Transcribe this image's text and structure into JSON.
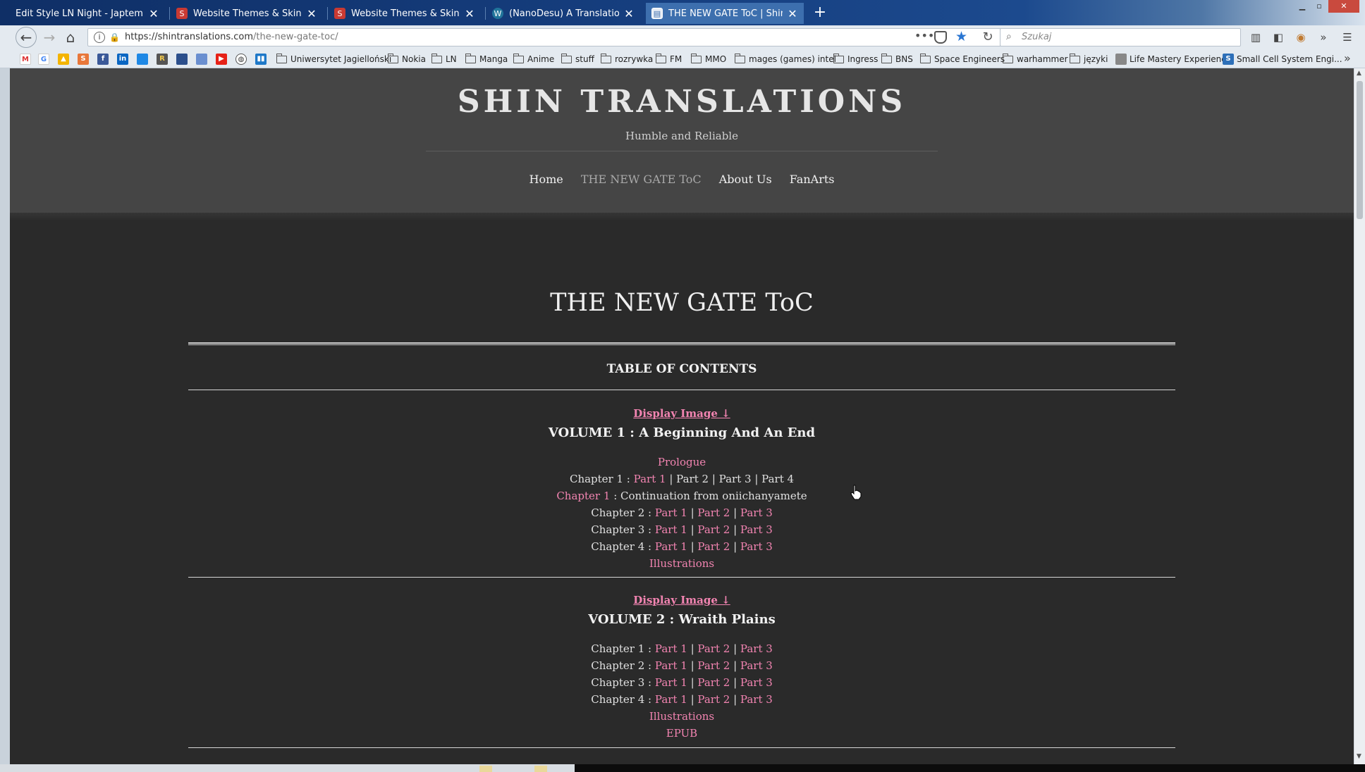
{
  "browser": {
    "tabs": [
      {
        "title": "Edit Style LN Night - Japtem",
        "favicon": "none"
      },
      {
        "title": "Website Themes & Skins by St",
        "favicon": "stylish-icon"
      },
      {
        "title": "Website Themes & Skins by St",
        "favicon": "stylish-icon"
      },
      {
        "title": "(NanoDesu) A Translation of th",
        "favicon": "wordpress-icon"
      },
      {
        "title": "THE NEW GATE ToC | Shin Tra",
        "favicon": "page-icon",
        "active": true
      }
    ],
    "url_host": "https://shintranslations.com",
    "url_path": "/the-new-gate-toc/",
    "search_placeholder": "Szukaj",
    "bookmark_folders": [
      "Uniwersytet Jagielloński",
      "Nokia",
      "LN",
      "Manga",
      "Anime",
      "stuff",
      "rozrywka",
      "FM",
      "MMO",
      "mages (games) intel",
      "Ingress",
      "BNS",
      "Space Engineers",
      "warhammer",
      "języki"
    ],
    "bookmark_links": [
      "Life Mastery Experience",
      "Small Cell System Engi..."
    ],
    "accent": "#f284b1"
  },
  "site": {
    "title": "SHIN TRANSLATIONS",
    "tagline": "Humble and Reliable",
    "menu": [
      "Home",
      "THE NEW GATE ToC",
      "About Us",
      "FanArts"
    ],
    "current_menu": "THE NEW GATE ToC"
  },
  "content": {
    "page_title": "THE NEW GATE ToC",
    "toc_heading": "TABLE OF CONTENTS",
    "display_image": "Display Image ↓",
    "sep": "|",
    "vol1": {
      "title": "VOLUME 1 : A Beginning And An End",
      "prologue": "Prologue",
      "ch1_label": "Chapter 1 :",
      "ch1_parts": [
        "Part 1",
        "Part 2",
        "Part 3",
        "Part 4"
      ],
      "cont_link": "Chapter 1",
      "cont_text": ": Continuation from oniichanyamete",
      "ch2_label": "Chapter 2 :",
      "ch3_label": "Chapter 3 :",
      "ch4_label": "Chapter 4 :",
      "parts": [
        "Part 1",
        "Part 2",
        "Part 3"
      ],
      "illustrations": "Illustrations"
    },
    "vol2": {
      "title": "VOLUME 2 : Wraith Plains",
      "ch1_label": "Chapter 1 :",
      "ch2_label": "Chapter 2 :",
      "ch3_label": "Chapter 3 :",
      "ch4_label": "Chapter 4 :",
      "parts": [
        "Part 1",
        "Part 2",
        "Part 3"
      ],
      "illustrations": "Illustrations",
      "epub": "EPUB"
    }
  }
}
